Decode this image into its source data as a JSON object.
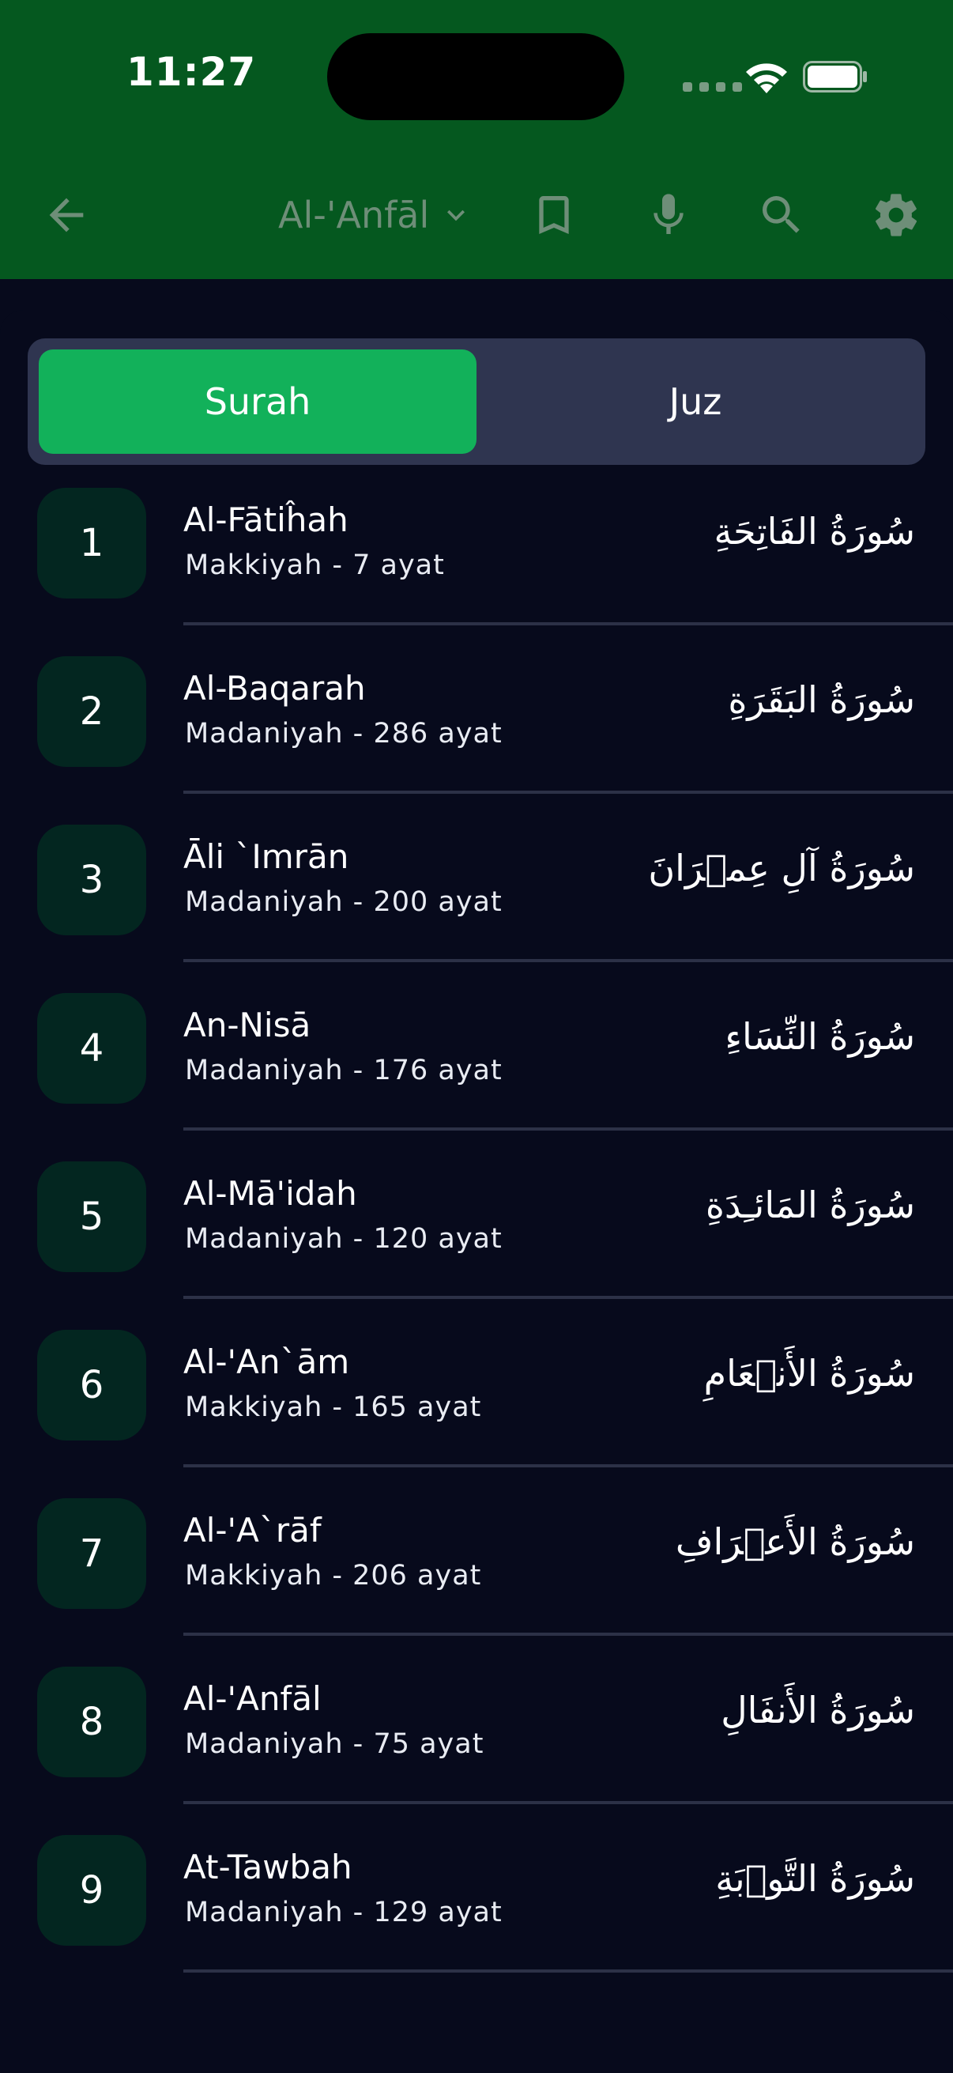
{
  "status_bar": {
    "time": "11:27"
  },
  "toolbar": {
    "current_surah": "Al-'Anfāl",
    "icons": [
      "back-arrow-icon",
      "chevron-down-icon",
      "bookmark-icon",
      "microphone-icon",
      "search-icon",
      "gear-icon"
    ]
  },
  "tabs": {
    "surah": "Surah",
    "juz": "Juz",
    "active": "Surah"
  },
  "colors": {
    "header": "#05581f",
    "background": "#070a1c",
    "active_tab": "#12b15a",
    "tab_bar": "#2f3550",
    "badge": "#032620"
  },
  "surahs": [
    {
      "number": "1",
      "name": "Al-Fātiĥah",
      "info": "Makkiyah - 7 ayat",
      "arabic": "سُورَةُ الفَاتِحَةِ"
    },
    {
      "number": "2",
      "name": "Al-Baqarah",
      "info": "Madaniyah - 286 ayat",
      "arabic": "سُورَةُ البَقَرَةِ"
    },
    {
      "number": "3",
      "name": "Āli `Imrān",
      "info": "Madaniyah - 200 ayat",
      "arabic": "سُورَةُ آلِ عِمۡرَانَ"
    },
    {
      "number": "4",
      "name": "An-Nisā",
      "info": "Madaniyah - 176 ayat",
      "arabic": "سُورَةُ النِّسَاءِ"
    },
    {
      "number": "5",
      "name": "Al-Mā'idah",
      "info": "Madaniyah - 120 ayat",
      "arabic": "سُورَةُ المَائـِدَةِ"
    },
    {
      "number": "6",
      "name": "Al-'An`ām",
      "info": "Makkiyah - 165 ayat",
      "arabic": "سُورَةُ الأَنۡعَامِ"
    },
    {
      "number": "7",
      "name": "Al-'A`rāf",
      "info": "Makkiyah - 206 ayat",
      "arabic": "سُورَةُ الأَعۡرَافِ"
    },
    {
      "number": "8",
      "name": "Al-'Anfāl",
      "info": "Madaniyah - 75 ayat",
      "arabic": "سُورَةُ الأَنفَالِ"
    },
    {
      "number": "9",
      "name": "At-Tawbah",
      "info": "Madaniyah - 129 ayat",
      "arabic": "سُورَةُ التَّوۡبَةِ"
    }
  ]
}
